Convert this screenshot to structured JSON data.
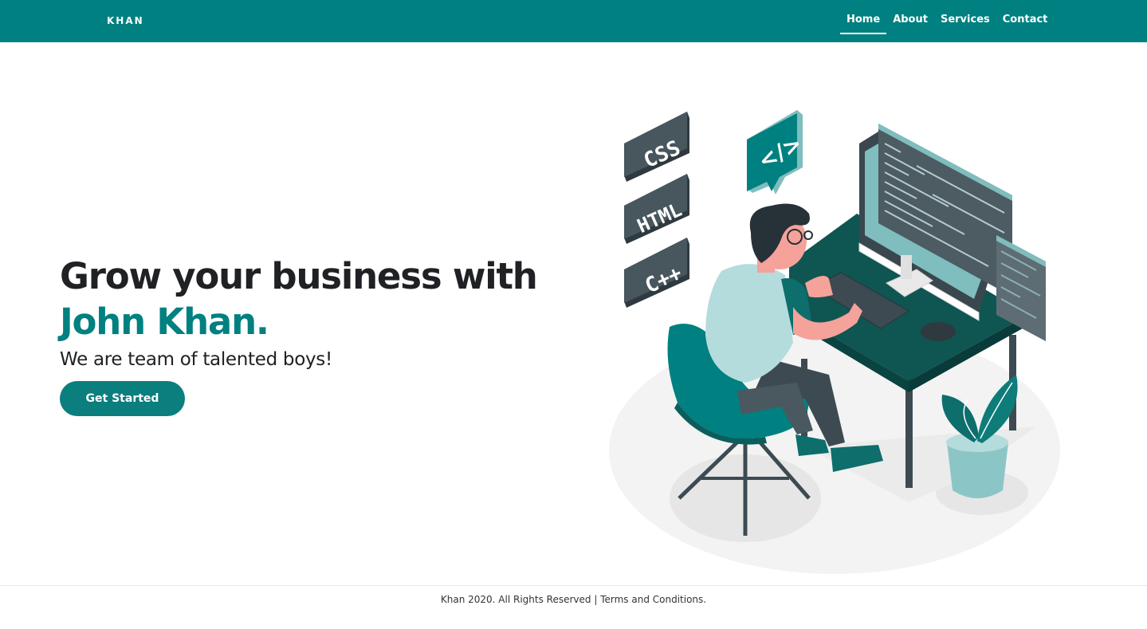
{
  "nav": {
    "brand": "KHAN",
    "links": [
      {
        "label": "Home",
        "active": true
      },
      {
        "label": "About"
      },
      {
        "label": "Services"
      },
      {
        "label": "Contact"
      }
    ]
  },
  "hero": {
    "headline_line1": "Grow your business with",
    "headline_name": "John Khan.",
    "tagline": "We are team of talented boys!",
    "cta_label": "Get Started"
  },
  "illustration": {
    "tiles": [
      "CSS",
      "HTML",
      "C++"
    ],
    "code_badge": "</>"
  },
  "footer": {
    "copyright": "Khan 2020. All Rights Reserved",
    "separator": "|",
    "terms_label": "Terms and Conditions."
  },
  "colors": {
    "primary": "#008080",
    "dark_text": "#202124",
    "illustration_dark": "#3d4a52",
    "illustration_light": "#b5dcdc"
  }
}
